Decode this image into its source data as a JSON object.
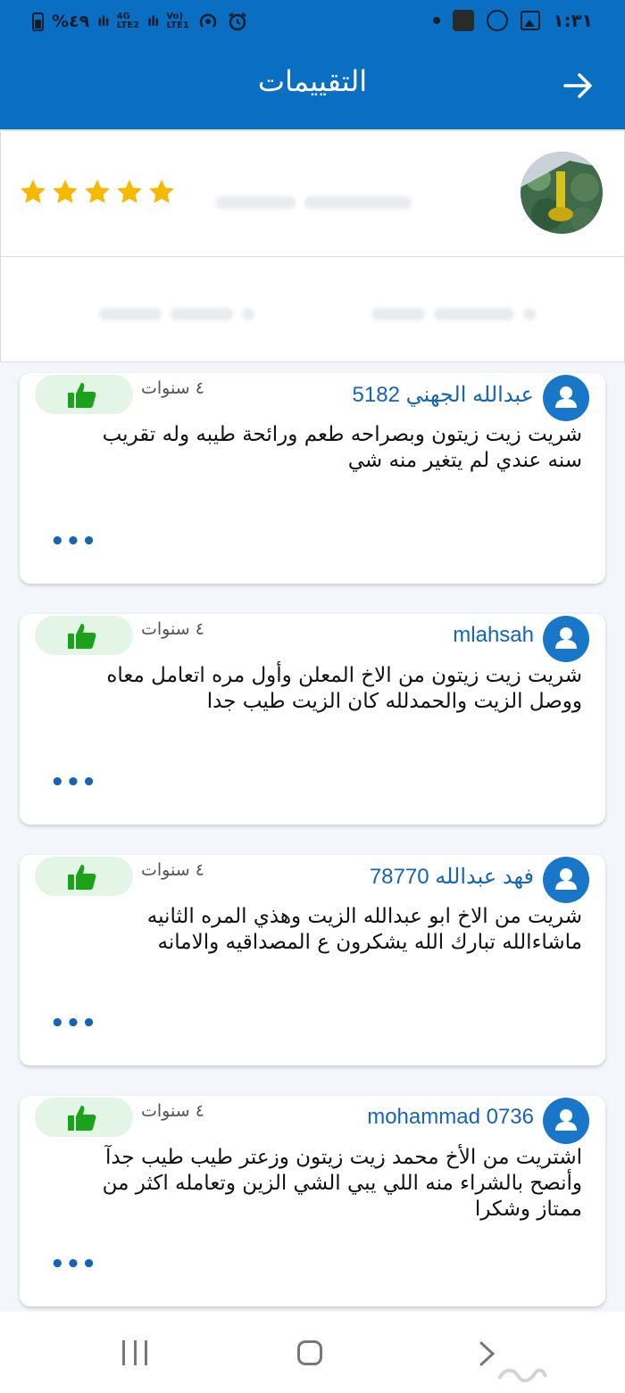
{
  "status_bar": {
    "battery": "%٤٩",
    "network_1": "4G\nLTE2",
    "network_2": "Vo)\nLTE1",
    "time": "١:٣١"
  },
  "app_bar": {
    "title": "التقييمات",
    "back_icon": "arrow-right-icon"
  },
  "summary": {
    "rating_stars": 5,
    "star_color": "#f6b800"
  },
  "reviews": [
    {
      "author": "عبدالله الجهني 5182",
      "time": "٤ سنوات",
      "text": "شريت زيت زيتون وبصراحه طعم ورائحة طيبه وله تقريب سنه عندي لم يتغير منه شي",
      "more": "•••"
    },
    {
      "author": "mlahsah",
      "time": "٤ سنوات",
      "text": "شريت زيت زيتون من الاخ المعلن وأول مره اتعامل معاه ووصل الزيت والحمدلله كان الزيت طيب جدا",
      "more": "•••"
    },
    {
      "author": "فهد عبدالله 78770",
      "time": "٤ سنوات",
      "text": "شريت من الاخ ابو عبدالله الزيت وهذي المره الثانيه ماشاءالله تبارك الله يشكرون ع المصداقيه والامانه",
      "more": "•••"
    },
    {
      "author": "mohammad 0736",
      "time": "٤ سنوات",
      "text": "اشتريت من الأخ محمد زيت زيتون وزعتر طيب طيب جدآ وأنصح بالشراء منه اللي يبي الشي الزين وتعامله اكثر من ممتاز  وشكرا",
      "more": "•••"
    }
  ],
  "colors": {
    "primary": "#0a6fc2",
    "like_bg": "#e3f6e6",
    "like_icon": "#1aa31a",
    "link": "#1565b4"
  }
}
